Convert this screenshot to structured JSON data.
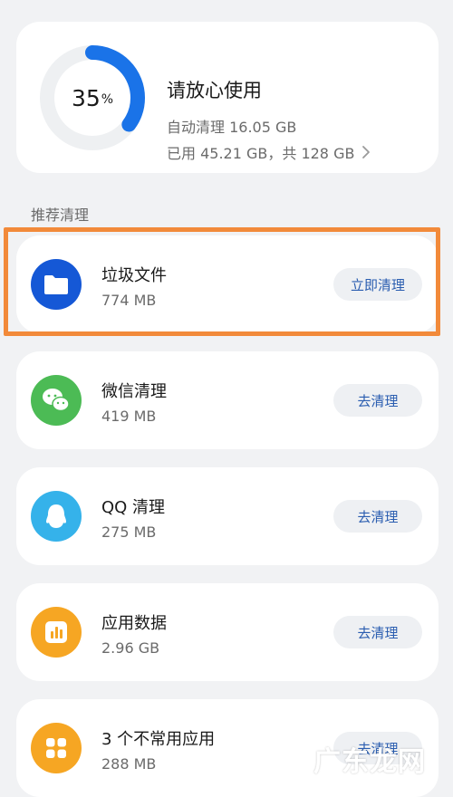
{
  "summary": {
    "percent": "35",
    "percent_unit": "%",
    "percent_value": 35,
    "title": "请放心使用",
    "auto_clean": "自动清理 16.05 GB",
    "usage": "已用 45.21 GB，共 128 GB",
    "ring_color": "#1a73e8",
    "ring_track_color": "#eef0f2"
  },
  "section_title": "推荐清理",
  "items": [
    {
      "title": "垃圾文件",
      "size": "774 MB",
      "action": "立即清理",
      "icon": "folder-icon",
      "color": "#1558d6"
    },
    {
      "title": "微信清理",
      "size": "419 MB",
      "action": "去清理",
      "icon": "wechat-icon",
      "color": "#4cbb55"
    },
    {
      "title": "QQ 清理",
      "size": "275 MB",
      "action": "去清理",
      "icon": "qq-icon",
      "color": "#35b2ea"
    },
    {
      "title": "应用数据",
      "size": "2.96 GB",
      "action": "去清理",
      "icon": "bar-chart-icon",
      "color": "#f6a623"
    },
    {
      "title": "3 个不常用应用",
      "size": "288 MB",
      "action": "去清理",
      "icon": "apps-grid-icon",
      "color": "#f6a623"
    }
  ],
  "watermark": "广东龙网",
  "highlight_color": "#f28a3a"
}
